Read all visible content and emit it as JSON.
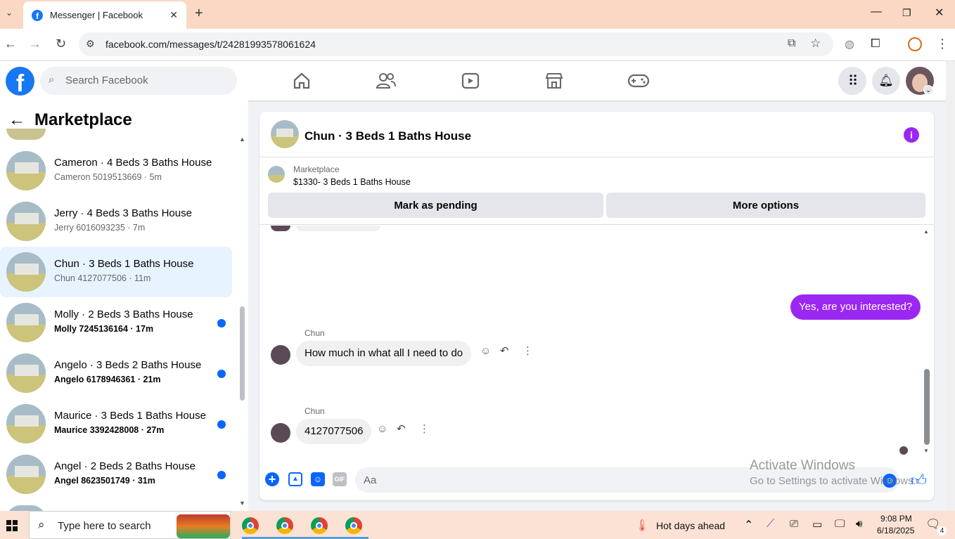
{
  "browser": {
    "tab_title": "Messenger | Facebook",
    "new_tab_label": "+",
    "url": "facebook.com/messages/t/24281993578061624"
  },
  "facebook": {
    "search_placeholder": "Search Facebook",
    "brand_color": "#1877f2"
  },
  "sidebar": {
    "title": "Marketplace",
    "conversations": [
      {
        "name": "Cameron · 4 Beds 3 Baths House",
        "sub": "Cameron 5019513669 · 5m",
        "unread": false,
        "selected": false
      },
      {
        "name": "Jerry · 4 Beds 3 Baths House",
        "sub": "Jerry 6016093235 · 7m",
        "unread": false,
        "selected": false
      },
      {
        "name": "Chun · 3 Beds 1 Baths House",
        "sub": "Chun 4127077506 · 11m",
        "unread": false,
        "selected": true
      },
      {
        "name": "Molly · 2 Beds 3 Baths House",
        "sub": "Molly 7245136164 · 17m",
        "unread": true,
        "selected": false
      },
      {
        "name": "Angelo · 3 Beds 2 Baths House",
        "sub": "Angelo 6178946361 · 21m",
        "unread": true,
        "selected": false
      },
      {
        "name": "Maurice · 3 Beds 1 Baths House",
        "sub": "Maurice 3392428008 · 27m",
        "unread": true,
        "selected": false
      },
      {
        "name": "Angel · 2 Beds 2 Baths House",
        "sub": "Angel 8623501749 · 31m",
        "unread": true,
        "selected": false
      }
    ]
  },
  "chat": {
    "title": "Chun · 3 Beds 1 Baths House",
    "listing_label": "Marketplace",
    "listing_price": "$1330- 3 Beds 1 Baths House",
    "mark_pending_label": "Mark as pending",
    "more_options_label": "More options",
    "messages": [
      {
        "from": "me",
        "text": "Yes, are you interested?"
      },
      {
        "from": "Chun",
        "sender_label": "Chun",
        "text": "How much in what all I need to do"
      },
      {
        "from": "Chun",
        "sender_label": "Chun",
        "text": "4127077506"
      }
    ],
    "composer_placeholder": "Aa",
    "gif_label": "GIF",
    "accent_color": "#9b27f2"
  },
  "watermark": {
    "line1": "Activate Windows",
    "line2": "Go to Settings to activate Windows."
  },
  "taskbar": {
    "search_placeholder": "Type here to search",
    "weather": "Hot days ahead",
    "time": "9:08 PM",
    "date": "6/18/2025",
    "notification_count": "4"
  }
}
